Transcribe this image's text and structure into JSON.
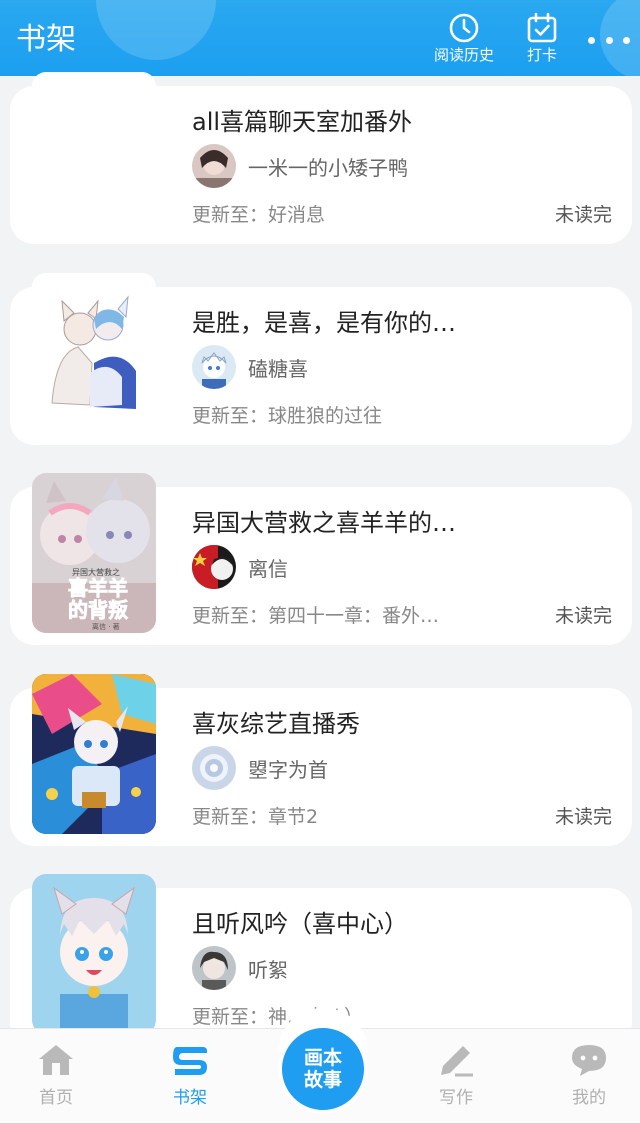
{
  "header": {
    "title": "书架",
    "history_label": "阅读历史",
    "checkin_label": "打卡"
  },
  "books": [
    {
      "title": "all喜篇聊天室加番外",
      "author": "一米一的小矮子鸭",
      "update": "更新至：好消息",
      "status": "未读完"
    },
    {
      "title": "是胜，是喜，是有你的…",
      "author": "磕糖喜",
      "update": "更新至：球胜狼的过往",
      "status": ""
    },
    {
      "title": "异国大营救之喜羊羊的…",
      "author": "离信",
      "update": "更新至：第四十一章：番外…",
      "status": "未读完",
      "cover_text": {
        "small": "异国大营救之",
        "big1": "喜羊羊",
        "big2": "的背叛",
        "tag": "离信 · 著"
      }
    },
    {
      "title": "喜灰综艺直播秀",
      "author": "曌字为首",
      "update": "更新至：章节2",
      "status": "未读完"
    },
    {
      "title": "且听风吟（喜中心）",
      "author": "听絮",
      "update": "更新至：神…十八）",
      "status": ""
    }
  ],
  "bottom_nav": {
    "home": "首页",
    "shelf": "书架",
    "center_line1": "画本",
    "center_line2": "故事",
    "write": "写作",
    "mine": "我的"
  },
  "colors": {
    "accent": "#1f9df0",
    "header": "#2aa8f0"
  },
  "icons": [
    "clock-icon",
    "calendar-check-icon",
    "more-icon",
    "home-icon",
    "shelf-icon",
    "pen-icon",
    "chat-icon"
  ]
}
